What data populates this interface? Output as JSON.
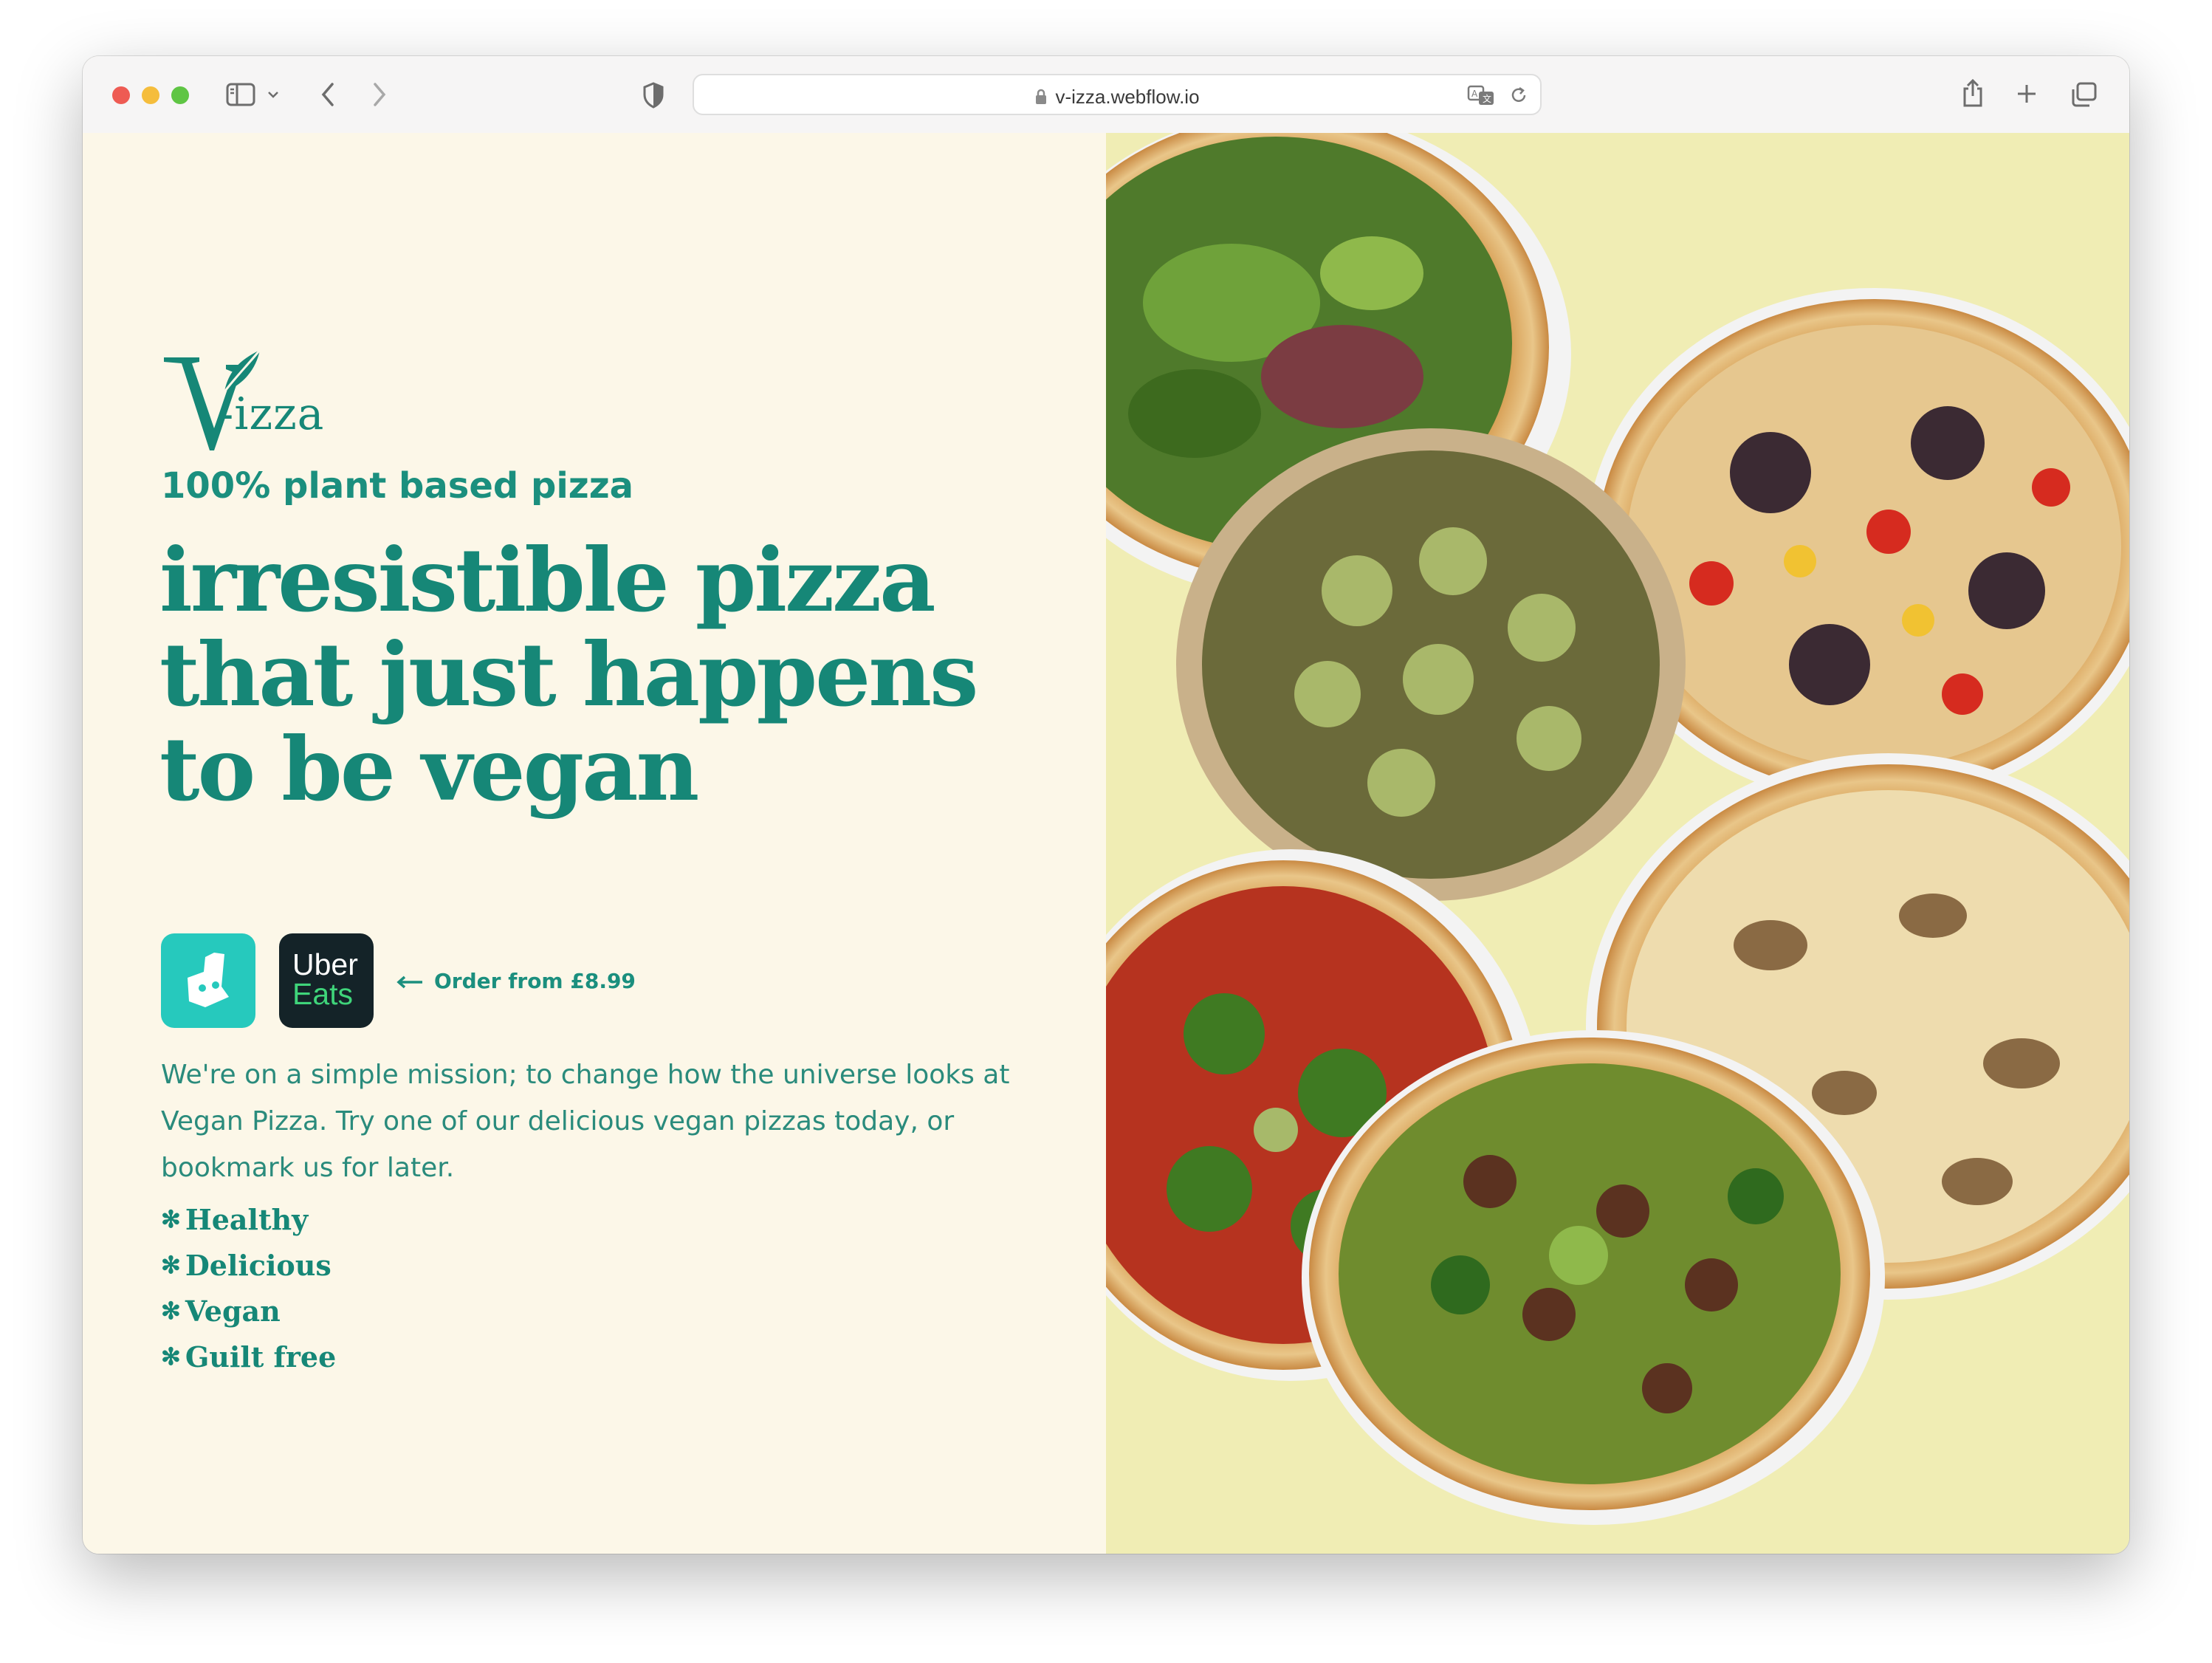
{
  "browser": {
    "url": "v-izza.webflow.io"
  },
  "brand": {
    "logo_v": "V",
    "logo_rest": "-izza",
    "primary_color": "#168777",
    "accent_color": "#f0edb4"
  },
  "hero": {
    "tagline": "100% plant based pizza",
    "headline_lines": [
      "irresistible pizza",
      "that just happens",
      "to be vegan"
    ],
    "order_text": "Order from £8.99",
    "uber_line1": "Uber",
    "uber_line2": "Eats",
    "mission_lines": [
      "We're on a simple mission; to change how the universe looks at",
      "Vegan Pizza. Try one of our delicious vegan pizzas today, or",
      "bookmark us for later."
    ],
    "features": [
      "Healthy",
      "Delicious",
      "Vegan",
      "Guilt free"
    ]
  }
}
